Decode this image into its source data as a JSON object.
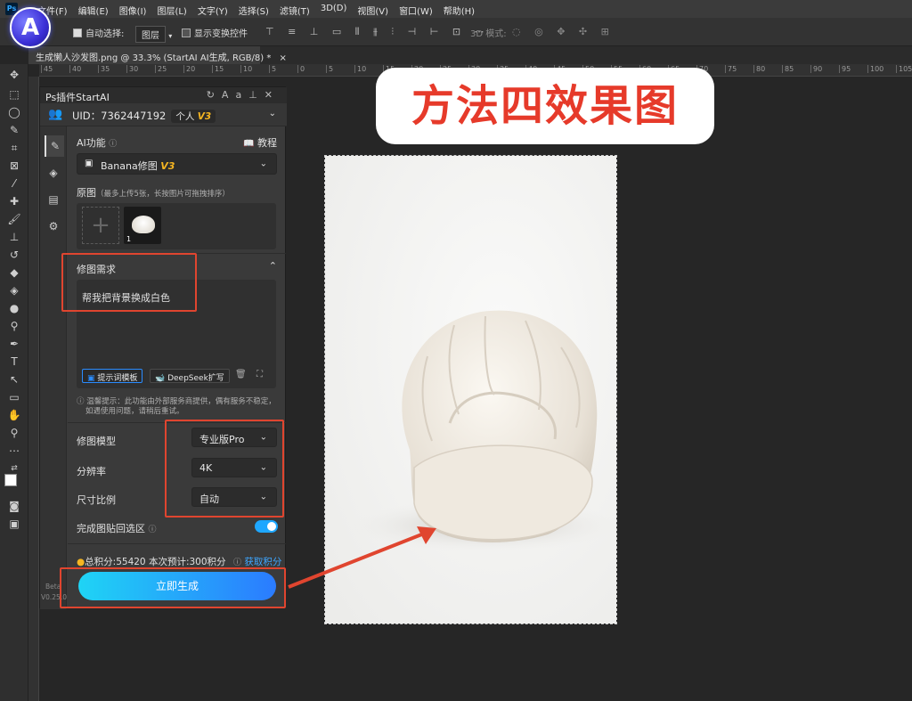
{
  "menubar": {
    "ps_logo": "Ps",
    "items": [
      "文件(F)",
      "编辑(E)",
      "图像(I)",
      "图层(L)",
      "文字(Y)",
      "选择(S)",
      "滤镜(T)",
      "3D(D)",
      "视图(V)",
      "窗口(W)",
      "帮助(H)"
    ]
  },
  "app_logo_letter": "A",
  "options": {
    "auto_select_label": "自动选择:",
    "layer_select": "图层",
    "show_transform_label": "显示变换控件",
    "mode_3d_label": "3D 模式:"
  },
  "doc_tab": {
    "title": "生成懒人沙发图.png @ 33.3% (StartAI AI生成, RGB/8) *",
    "close": "×"
  },
  "ruler_numbers": [
    "45",
    "40",
    "35",
    "30",
    "25",
    "20",
    "15",
    "10",
    "5",
    "0",
    "5",
    "10",
    "15",
    "20",
    "25",
    "30",
    "35",
    "40",
    "45",
    "50",
    "55",
    "60",
    "65",
    "70",
    "75",
    "80",
    "85",
    "90",
    "95",
    "100",
    "105"
  ],
  "plugin": {
    "title": "Ps插件StartAI",
    "uid_text": "UID：7362447192",
    "account_badge": "个人",
    "version_badge": "V3",
    "ai_function_label": "AI功能",
    "tutorial_label": "教程",
    "model_value": "Banana修图",
    "original_label": "原图",
    "original_hint": "（最多上传5张，长按图片可拖拽排序）",
    "thumb_number": "1",
    "requirement_label": "修图需求",
    "requirement_text": "帮我把背景换成白色",
    "template_button": "提示词模板",
    "deepseek_button": "DeepSeek扩写",
    "tip_line1": "温馨提示：此功能由外部服务商提供，偶有服务不稳定，",
    "tip_line2": "如遇使用问题，请稍后重试。",
    "model_label": "修图模型",
    "model_select": "专业版Pro",
    "resolution_label": "分辨率",
    "resolution_select": "4K",
    "ratio_label": "尺寸比例",
    "ratio_select": "自动",
    "paste_back_label": "完成图贴回选区",
    "paste_back_on": true,
    "points_text": "总积分:55420  本次预计:300积分",
    "get_points_link": "获取积分",
    "generate_button": "立即生成",
    "beta_label": "Beta",
    "version_label": "V0.25.0"
  },
  "banner_text": "方法四效果图",
  "colors": {
    "accent_red": "#e0452f",
    "banner_red": "#e63a2a",
    "toggle_blue": "#1ea7ff",
    "version_gold": "#f5b521"
  }
}
